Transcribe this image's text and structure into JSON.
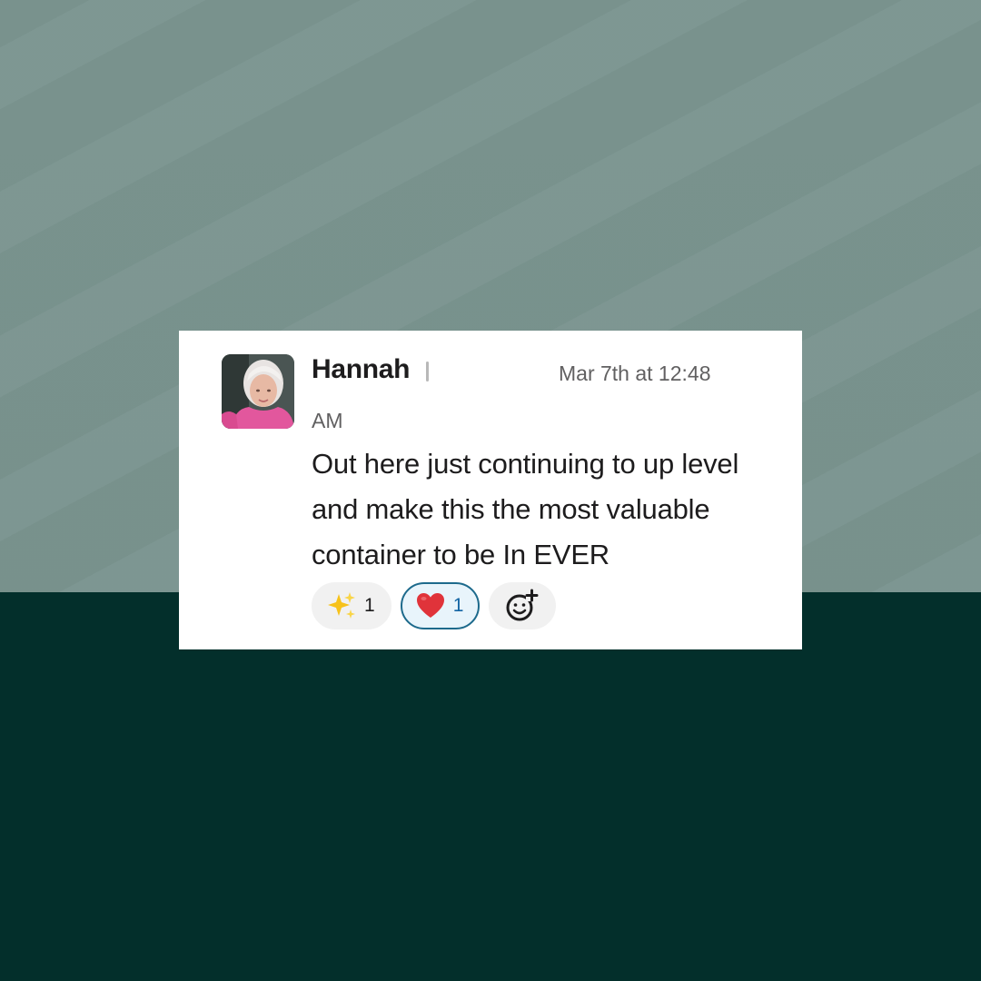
{
  "message": {
    "sender": "Hannah",
    "timestamp_line1": "Mar 7th at 12:48",
    "timestamp_line2": "AM",
    "text": "Out here just continuing to up level and make this the most valuable container to be In EVER",
    "avatar_icon": "user-photo-avatar"
  },
  "reactions": [
    {
      "icon": "sparkles-icon",
      "emoji": "✨",
      "count": "1",
      "active": false
    },
    {
      "icon": "heart-icon",
      "emoji": "❤️",
      "count": "1",
      "active": true
    }
  ],
  "add_reaction": {
    "icon": "add-reaction-icon"
  },
  "colors": {
    "background_top": "#7b9590",
    "background_bottom": "#032f2b",
    "card": "#ffffff",
    "active_reaction_border": "#1d6a8c",
    "heart": "#e0333a"
  }
}
